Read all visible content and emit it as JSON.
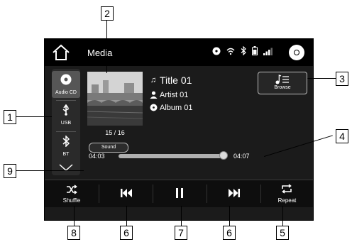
{
  "header": {
    "title": "Media"
  },
  "sources": [
    {
      "label": "Audio CD",
      "icon": "disc-icon"
    },
    {
      "label": "USB",
      "icon": "usb-icon"
    },
    {
      "label": "BT",
      "icon": "bluetooth-icon"
    }
  ],
  "track": {
    "title": "Title 01",
    "artist": "Artist 01",
    "album": "Album 01",
    "position_label": "15 / 16"
  },
  "buttons": {
    "browse": "Browse",
    "sound": "Sound"
  },
  "progress": {
    "elapsed": "04:03",
    "total": "04:07",
    "fraction": 0.985
  },
  "controls": {
    "shuffle": "Shuffle",
    "repeat": "Repeat"
  },
  "callouts": [
    "1",
    "2",
    "3",
    "4",
    "5",
    "6",
    "6",
    "7",
    "8",
    "9"
  ],
  "colors": {
    "screen_bg": "#1b1b1b",
    "statusbar_bg": "#000000",
    "text": "#ffffff"
  }
}
